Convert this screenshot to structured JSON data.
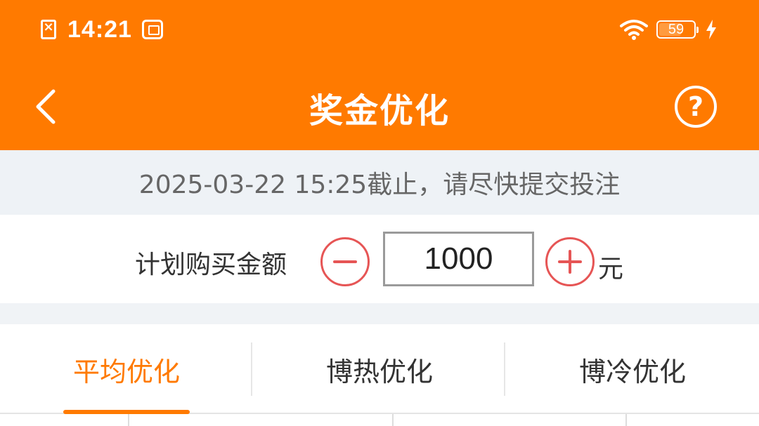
{
  "status_bar": {
    "time": "14:21",
    "battery_level": "59",
    "icons": [
      "sim-error-icon",
      "app-notification-icon",
      "wifi-icon",
      "battery-icon",
      "charging-bolt-icon"
    ]
  },
  "nav": {
    "title": "奖金优化",
    "back_icon": "chevron-left-icon",
    "help_icon": "question-circle-icon"
  },
  "deadline": {
    "text": "2025-03-22 15:25截止，请尽快提交投注"
  },
  "amount": {
    "label": "计划购买金额",
    "value": "1000",
    "unit": "元",
    "minus_icon": "minus-circle-icon",
    "plus_icon": "plus-circle-icon"
  },
  "tabs": [
    {
      "label": "平均优化",
      "active": true
    },
    {
      "label": "博热优化",
      "active": false
    },
    {
      "label": "博冷优化",
      "active": false
    }
  ],
  "colors": {
    "brand": "#ff7a00",
    "accent_red": "#e65555",
    "deadline_bg": "#eef2f6"
  }
}
